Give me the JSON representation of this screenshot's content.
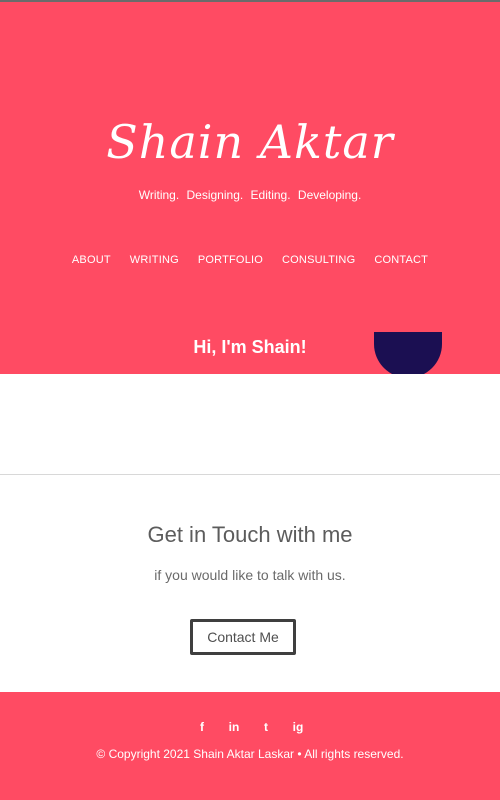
{
  "site": {
    "title": "Shain Aktar",
    "tagline": "Writing.  Designing.  Editing.  Developing."
  },
  "nav": {
    "items": [
      {
        "label": "ABOUT"
      },
      {
        "label": "WRITING"
      },
      {
        "label": "PORTFOLIO"
      },
      {
        "label": "CONSULTING"
      },
      {
        "label": "CONTACT"
      }
    ]
  },
  "hero": {
    "greeting": "Hi, I'm Shain!"
  },
  "contact": {
    "title": "Get in Touch with me",
    "subtitle": "if you would like to talk with us.",
    "button_label": "Contact Me"
  },
  "footer": {
    "social": {
      "facebook": "f",
      "linkedin": "in",
      "twitter": "t",
      "instagram": "ig"
    },
    "copyright": "© Copyright 2021 Shain Aktar Laskar • All rights reserved."
  },
  "colors": {
    "accent": "#ff4b63",
    "dark_blob": "#1b0f52"
  }
}
